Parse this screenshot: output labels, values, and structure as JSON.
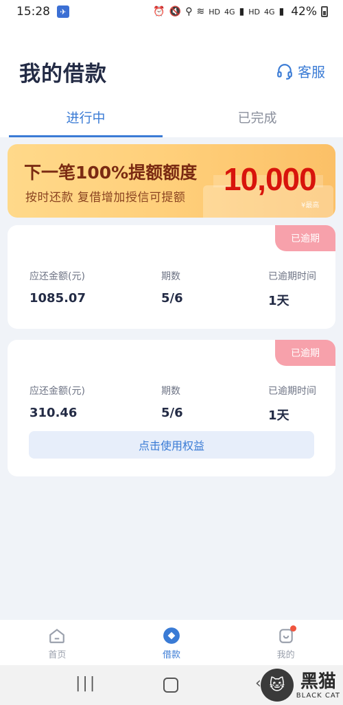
{
  "status_bar": {
    "time": "15:28",
    "net_hd1": "HD",
    "net_4g1": "4G",
    "net_hd2": "HD",
    "net_4g2": "4G",
    "battery": "42%"
  },
  "header": {
    "title": "我的借款",
    "service_label": "客服"
  },
  "tabs": [
    {
      "label": "进行中",
      "active": true
    },
    {
      "label": "已完成",
      "active": false
    }
  ],
  "banner": {
    "line1": "下一笔100%提额额度",
    "line2": "按时还款  复借增加授信可提额",
    "amount": "10,000",
    "max_tag": "¥最高"
  },
  "loans": [
    {
      "status": "已逾期",
      "amount_label": "应还金额(元)",
      "amount": "1085.07",
      "period_label": "期数",
      "period": "5/6",
      "overdue_label": "已逾期时间",
      "overdue_time": "1天"
    },
    {
      "status": "已逾期",
      "amount_label": "应还金额(元)",
      "amount": "310.46",
      "period_label": "期数",
      "period": "5/6",
      "overdue_label": "已逾期时间",
      "overdue_time": "1天",
      "button": "点击使用权益"
    }
  ],
  "bottom_nav": [
    {
      "label": "首页",
      "icon": "home-icon"
    },
    {
      "label": "借款",
      "icon": "loan-icon",
      "active": true
    },
    {
      "label": "我的",
      "icon": "profile-icon"
    }
  ],
  "watermark": {
    "cn": "黑猫",
    "en": "BLACK CAT"
  },
  "colors": {
    "accent": "#3a7bd5",
    "overdue_badge": "#f7a1ab",
    "banner_amount": "#d8140c",
    "notification_dot": "#f0553f"
  }
}
